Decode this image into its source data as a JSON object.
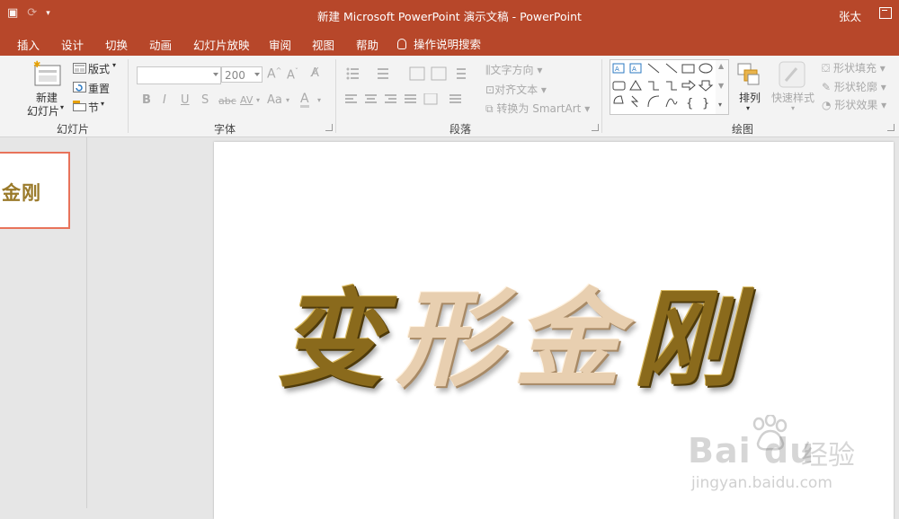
{
  "window": {
    "title": "新建 Microsoft PowerPoint 演示文稿 - PowerPoint",
    "user": "张太"
  },
  "tabs": [
    "插入",
    "设计",
    "切换",
    "动画",
    "幻灯片放映",
    "审阅",
    "视图",
    "帮助"
  ],
  "tell_me": "操作说明搜索",
  "ribbon": {
    "slides": {
      "new_slide_line1": "新建",
      "new_slide_line2": "幻灯片",
      "layout": "版式",
      "reset": "重置",
      "section": "节",
      "group_label": "幻灯片"
    },
    "font": {
      "font_name": "",
      "font_size": "200",
      "bold": "B",
      "italic": "I",
      "underline": "U",
      "shadow": "S",
      "strike": "abc",
      "spacing": "AV",
      "change_case": "Aa",
      "font_color": "A",
      "group_label": "字体"
    },
    "paragraph": {
      "text_direction": "文字方向",
      "align_text": "对齐文本",
      "smartart": "转换为 SmartArt",
      "group_label": "段落"
    },
    "drawing": {
      "arrange": "排列",
      "quick_styles": "快速样式",
      "shape_fill": "形状填充",
      "shape_outline": "形状轮廓",
      "shape_effects": "形状效果",
      "group_label": "绘图"
    }
  },
  "thumbnail": {
    "text": "金刚"
  },
  "slide": {
    "chars": [
      "变",
      "形",
      "金",
      "刚"
    ]
  },
  "watermark": {
    "brand": "Bai du",
    "cn": "经验",
    "url": "jingyan.baidu.com"
  },
  "colors": {
    "accent": "#b7472a",
    "thumb_border": "#e8735a",
    "wordart_gold": "#8a6a1c",
    "wordart_light": "#e8cfb0"
  }
}
